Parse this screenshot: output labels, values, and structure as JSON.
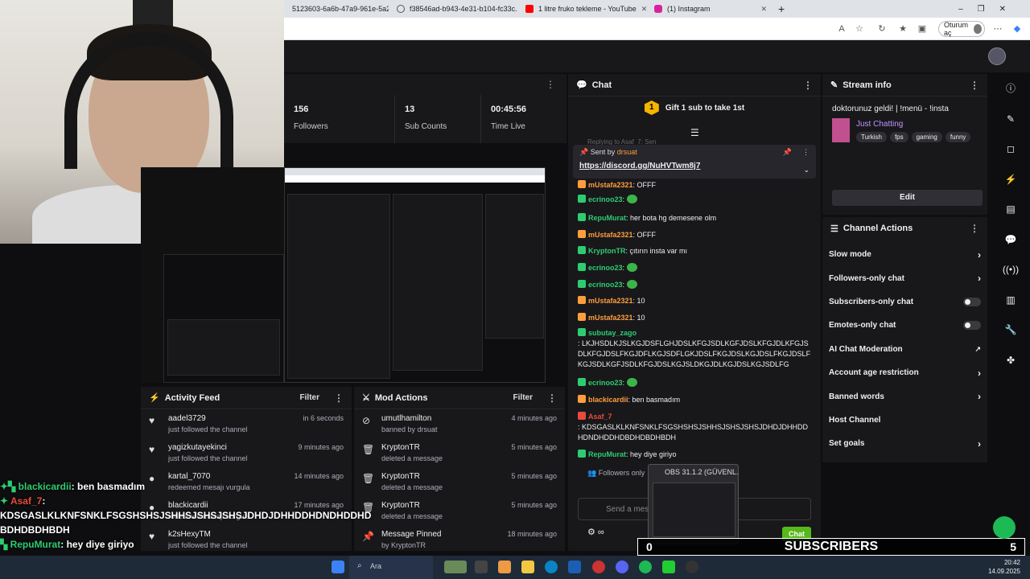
{
  "browser": {
    "tabs": [
      {
        "label": "5123603-6a6b-47a9-961e-5a2...",
        "color": "#777"
      },
      {
        "label": "f38546ad-b943-4e31-b104-fc33c...",
        "color": "#777"
      },
      {
        "label": "1 litre fruko tekleme - YouTube",
        "color": "#ff0000"
      },
      {
        "label": "(1) Instagram",
        "color": "#d6249f"
      }
    ],
    "signin_label": "Oturum aç"
  },
  "stats": [
    {
      "value": "156",
      "label": "Followers"
    },
    {
      "value": "13",
      "label": "Sub Counts"
    },
    {
      "value": "00:45:56",
      "label": "Time Live"
    }
  ],
  "activity": {
    "title": "Activity Feed",
    "filter": "Filter",
    "items": [
      {
        "name": "aadel3729",
        "desc": "just followed the channel",
        "time": "in 6 seconds",
        "icon": "heart-icon"
      },
      {
        "name": "yagizkutayekinci",
        "desc": "just followed the channel",
        "time": "9 minutes ago",
        "icon": "heart-icon"
      },
      {
        "name": "kartal_7070",
        "desc": "redeemed mesajı vurgula",
        "time": "14 minutes ago",
        "icon": "star-icon"
      },
      {
        "name": "blackicardii",
        "desc": "redeemed mesajı vurgula",
        "time": "17 minutes ago",
        "icon": "star-icon"
      },
      {
        "name": "k2sHexyTM",
        "desc": "just followed the channel",
        "time": "",
        "icon": "heart-icon"
      }
    ]
  },
  "modactions": {
    "title": "Mod Actions",
    "filter": "Filter",
    "items": [
      {
        "name": "umutlhamilton",
        "desc": "banned by drsuat",
        "time": "4 minutes ago",
        "icon": "ban-icon"
      },
      {
        "name": "KryptonTR",
        "desc": "deleted a message",
        "time": "5 minutes ago",
        "icon": "trash-icon"
      },
      {
        "name": "KryptonTR",
        "desc": "deleted a message",
        "time": "5 minutes ago",
        "icon": "trash-icon"
      },
      {
        "name": "KryptonTR",
        "desc": "deleted a message",
        "time": "5 minutes ago",
        "icon": "trash-icon"
      },
      {
        "name": "Message Pinned",
        "desc": "by KryptonTR",
        "time": "18 minutes ago",
        "icon": "pin-icon"
      }
    ]
  },
  "chat": {
    "title": "Chat",
    "gift_text": "Gift 1 sub to take 1st",
    "gift_rank": "1",
    "replying": "Replying to Asaf_7: Sen",
    "pinned_sent_by": "Sent by",
    "pinned_user": "drsuat",
    "pinned_link": "https://discord.gg/NuHVTwm8j7",
    "messages": [
      {
        "user": "mUstafa2321",
        "text": ": OFFF",
        "color": "#ff9e3d"
      },
      {
        "user": "ecrinoo23",
        "text": ":",
        "color": "#2ecc71",
        "emote": true
      },
      {
        "user": "RepuMurat",
        "text": ": her bota hg demesene olm",
        "color": "#2ecc71"
      },
      {
        "user": "mUstafa2321",
        "text": ": OFFF",
        "color": "#ff9e3d"
      },
      {
        "user": "KryptonTR",
        "text": ": çıtırın insta var mı",
        "color": "#2ecc71"
      },
      {
        "user": "ecrinoo23",
        "text": ":",
        "color": "#2ecc71",
        "emote": true
      },
      {
        "user": "ecrinoo23",
        "text": ":",
        "color": "#2ecc71",
        "emote": true
      },
      {
        "user": "mUstafa2321",
        "text": ": 10",
        "color": "#ff9e3d"
      },
      {
        "user": "mUstafa2321",
        "text": ": 10",
        "color": "#ff9e3d"
      },
      {
        "user": "subutay_zago",
        "text": ": LKJHSDLKJSLKGJDSFLGHJDSLKFGJSDLKGFJDSLKFGJDLKFGJSDLKFGJDSLFKGJDFLKGJSDFLGKJDSLFKGJDSLKGJDSLFKGJDSLFKGJSDLKGFJSDLKFGJDSLKGJSLDKGJDLKGJDSLKGJSDLFG",
        "color": "#2ecc71"
      },
      {
        "user": "ecrinoo23",
        "text": ":",
        "color": "#2ecc71",
        "emote": true
      },
      {
        "user": "blackicardii",
        "text": ": ben basmadım",
        "color": "#ff9e3d"
      },
      {
        "user": "Asaf_7",
        "text": ": KDSGASLKLKNFSNKLFSGSHSHSJSHHSJSHSJSHSJDHDJDHHDDHDNDHDDHDBDHDBDHBDH",
        "color": "#e74c3c"
      },
      {
        "user": "RepuMurat",
        "text": ": hey diye giriyo",
        "color": "#2ecc71"
      }
    ],
    "followers_only": "Followers only",
    "input_placeholder": "Send a message",
    "send_label": "Chat"
  },
  "streaminfo": {
    "title": "Stream info",
    "stream_title": "doktorunuz geldi! | !menü - !insta",
    "category": "Just Chatting",
    "tags": [
      "Turkish",
      "fps",
      "gaming",
      "funny"
    ],
    "edit": "Edit"
  },
  "channelactions": {
    "title": "Channel Actions",
    "items": [
      {
        "label": "Slow mode",
        "kind": "chevron"
      },
      {
        "label": "Followers-only chat",
        "kind": "chevron"
      },
      {
        "label": "Subscribers-only chat",
        "kind": "toggle"
      },
      {
        "label": "Emotes-only chat",
        "kind": "toggle"
      },
      {
        "label": "AI Chat Moderation",
        "kind": "external"
      },
      {
        "label": "Account age restriction",
        "kind": "chevron"
      },
      {
        "label": "Banned words",
        "kind": "chevron"
      },
      {
        "label": "Host Channel",
        "kind": "none"
      },
      {
        "label": "Set goals",
        "kind": "chevron"
      }
    ]
  },
  "overlay": {
    "l1_user": "blackicardii",
    "l1_text": ": ben basmadım",
    "l2_user": "Asaf_7",
    "l2_text": ":",
    "l3_text": "KDSGASLKLKNFSNKLFSGSHSHSJSHHSJSHSJSHSJDHDJDHHDDHDNDHDDHD",
    "l4_text": "BDHDBDHBDH",
    "l5_user": "RepuMurat",
    "l5_text": ": hey diye giriyo",
    "subs_left": "0",
    "subs_label": "SUBSCRIBERS",
    "subs_right": "5",
    "obs_title": "OBS 31.1.2 (GÜVENL..."
  },
  "taskbar": {
    "search": "Ara",
    "time": "20:42",
    "date": "14.09.2025"
  }
}
